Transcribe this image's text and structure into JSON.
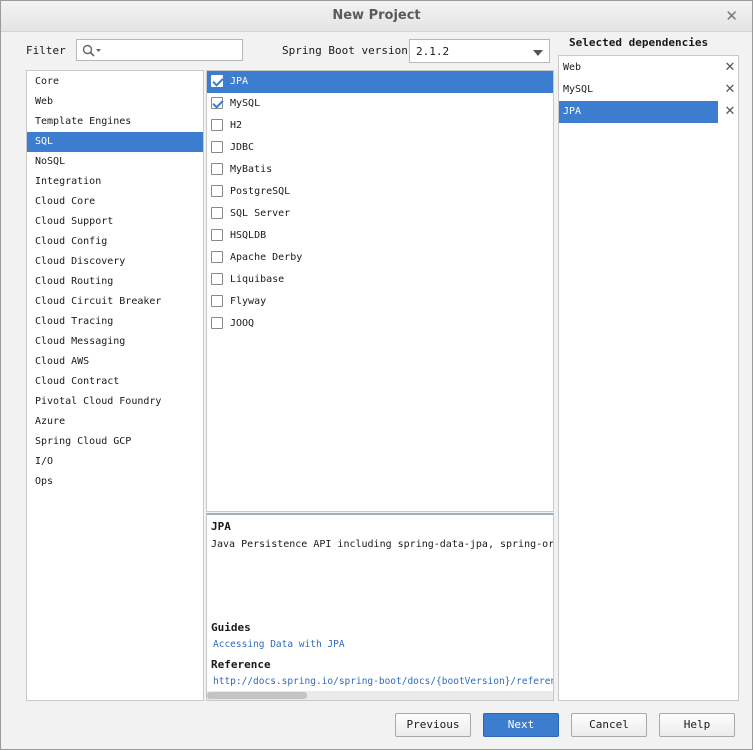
{
  "window": {
    "title": "New Project",
    "close_glyph": "✕"
  },
  "filter": {
    "label": "Filter",
    "value": "",
    "icon": "search-icon"
  },
  "boot_version": {
    "label": "Spring Boot version",
    "value": "2.1.2"
  },
  "categories": [
    {
      "label": "Core"
    },
    {
      "label": "Web"
    },
    {
      "label": "Template Engines"
    },
    {
      "label": "SQL",
      "selected": true
    },
    {
      "label": "NoSQL"
    },
    {
      "label": "Integration"
    },
    {
      "label": "Cloud Core"
    },
    {
      "label": "Cloud Support"
    },
    {
      "label": "Cloud Config"
    },
    {
      "label": "Cloud Discovery"
    },
    {
      "label": "Cloud Routing"
    },
    {
      "label": "Cloud Circuit Breaker"
    },
    {
      "label": "Cloud Tracing"
    },
    {
      "label": "Cloud Messaging"
    },
    {
      "label": "Cloud AWS"
    },
    {
      "label": "Cloud Contract"
    },
    {
      "label": "Pivotal Cloud Foundry"
    },
    {
      "label": "Azure"
    },
    {
      "label": "Spring Cloud GCP"
    },
    {
      "label": "I/O"
    },
    {
      "label": "Ops"
    }
  ],
  "dependencies": [
    {
      "label": "JPA",
      "checked": true,
      "selected": true
    },
    {
      "label": "MySQL",
      "checked": true
    },
    {
      "label": "H2",
      "checked": false
    },
    {
      "label": "JDBC",
      "checked": false
    },
    {
      "label": "MyBatis",
      "checked": false
    },
    {
      "label": "PostgreSQL",
      "checked": false
    },
    {
      "label": "SQL Server",
      "checked": false
    },
    {
      "label": "HSQLDB",
      "checked": false
    },
    {
      "label": "Apache Derby",
      "checked": false
    },
    {
      "label": "Liquibase",
      "checked": false
    },
    {
      "label": "Flyway",
      "checked": false
    },
    {
      "label": "JOOQ",
      "checked": false
    }
  ],
  "description": {
    "title": "JPA",
    "text": "Java Persistence API including spring-data-jpa, spring-orm and Hibernate",
    "guides_heading": "Guides",
    "guide_link": "Accessing Data with JPA",
    "reference_heading": "Reference",
    "reference_link": "http://docs.spring.io/spring-boot/docs/{bootVersion}/reference/htmlsingle/#boot-features-jpa-and-spring-data"
  },
  "selected_dependencies": {
    "header": "Selected dependencies",
    "items": [
      {
        "label": "Web"
      },
      {
        "label": "MySQL"
      },
      {
        "label": "JPA",
        "selected": true
      }
    ],
    "remove_glyph": "✕"
  },
  "buttons": {
    "previous": "Previous",
    "next": "Next",
    "cancel": "Cancel",
    "help": "Help"
  },
  "colors": {
    "accent": "#3d7dcf",
    "link": "#2f6bbd"
  }
}
